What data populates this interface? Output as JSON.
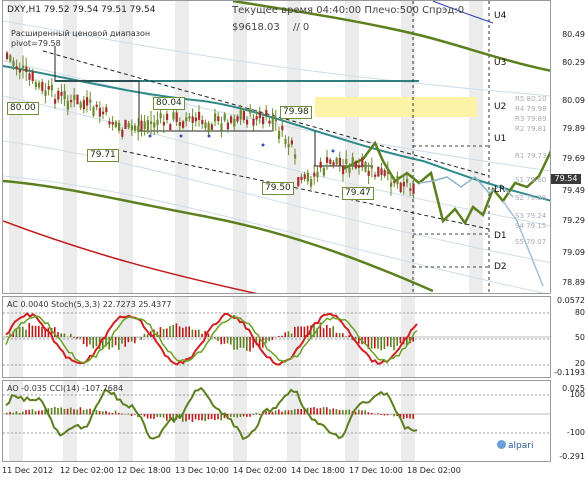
{
  "main_chart": {
    "header_ohlc": "DXY,H1  79.52 79.54 79.51 79.54",
    "info": "Текущее время 04:40:00 Плечо:500 Спрэд:0",
    "balance": "$9618.03",
    "balance_suffix": "// 0",
    "range_label": "Расширенный ценовой диапазон",
    "pivot_label": "pivot=79.58",
    "current_price": "79.54",
    "price_ticks": [
      "80.49",
      "80.29",
      "80.09",
      "79.89",
      "79.69",
      "79.49",
      "79.29",
      "79.09",
      "78.89"
    ],
    "price_tags": [
      "80.00",
      "80.04",
      "79.98",
      "79.71",
      "79.50",
      "79.47"
    ],
    "levels": [
      "U4",
      "U3",
      "U2",
      "U1",
      "LR",
      "D1",
      "D2"
    ],
    "faint_labels": [
      "R5 80.10",
      "R4 79.98",
      "R3 79.89",
      "R2 79.81",
      "R1 79.73",
      "S1 79.60",
      "S2 79.38",
      "S3 79.24",
      "S4 79.15",
      "S5 79.07"
    ]
  },
  "ac_panel": {
    "title": "AC 0.0040  Stoch(5,3,3) 22.7273 25.4377",
    "ticks": [
      "0.0572",
      "80",
      "50",
      "20",
      "-0.1193"
    ]
  },
  "ao_panel": {
    "title": "AO -0.035  CCI(14) -107.7684",
    "ticks": [
      "0.025",
      "100",
      "-100",
      "-0.291"
    ]
  },
  "time_axis": [
    "11 Dec 2012",
    "12 Dec 02:00",
    "12 Dec 18:00",
    "13 Dec 10:00",
    "14 Dec 02:00",
    "14 Dec 18:00",
    "17 Dec 10:00",
    "18 Dec 02:00"
  ],
  "brand": "alpari",
  "colors": {
    "olive": "#5c7f1e",
    "teal": "#2f8a8a",
    "red": "#c01818",
    "dark_red": "#a62b2b",
    "pale_band": "#dde6ee",
    "session_band": "#ececec",
    "zone_yellow": "#fdf3a6",
    "axis_bg": "#3a3a3a"
  }
}
